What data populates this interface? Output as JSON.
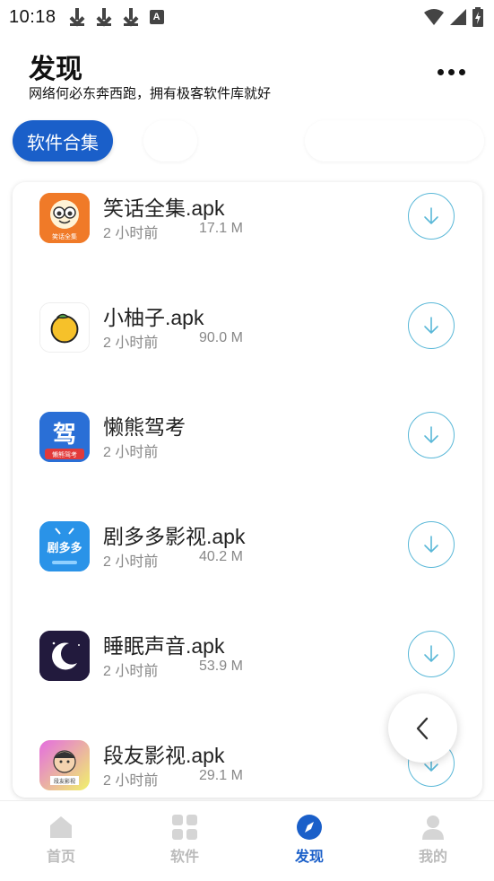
{
  "status_bar": {
    "time": "10:18",
    "notification_icons": [
      "download-icon",
      "download-icon",
      "download-icon",
      "a-icon"
    ],
    "a_badge": "A",
    "right_icons": [
      "wifi-icon",
      "signal-icon",
      "battery-charging-icon"
    ]
  },
  "header": {
    "title": "发现",
    "subtitle": "网络何必东奔西跑，拥有极客软件库就好",
    "more_icon": "more-icon"
  },
  "chips": {
    "active_label": "软件合集"
  },
  "apps": [
    {
      "name": "笑话全集.apk",
      "time": "2 小时前",
      "size": "17.1 M",
      "icon": "joke-app-icon",
      "icon_label": "笑话全集"
    },
    {
      "name": "小柚子.apk",
      "time": "2 小时前",
      "size": "90.0 M",
      "icon": "grapefruit-app-icon"
    },
    {
      "name": "懒熊驾考",
      "time": "2 小时前",
      "size": "",
      "icon": "driving-app-icon",
      "icon_label": "懒熊驾考",
      "icon_glyph": "驾"
    },
    {
      "name": "剧多多影视.apk",
      "time": "2 小时前",
      "size": "40.2 M",
      "icon": "video-app-icon",
      "icon_label": "剧多多"
    },
    {
      "name": "睡眠声音.apk",
      "time": "2 小时前",
      "size": "53.9 M",
      "icon": "sleep-app-icon"
    },
    {
      "name": "段友影视.apk",
      "time": "2 小时前",
      "size": "29.1 M",
      "icon": "duanyou-app-icon",
      "icon_label": "段友影视"
    }
  ],
  "bottom_nav": [
    {
      "label": "首页",
      "icon": "home-icon",
      "active": false
    },
    {
      "label": "软件",
      "icon": "grid-icon",
      "active": false
    },
    {
      "label": "发现",
      "icon": "compass-icon",
      "active": true
    },
    {
      "label": "我的",
      "icon": "user-icon",
      "active": false
    }
  ],
  "colors": {
    "accent": "#1a5fc9",
    "download_ring": "#5ab8d8",
    "muted_text": "#888888",
    "nav_inactive": "#bbbbbb"
  }
}
